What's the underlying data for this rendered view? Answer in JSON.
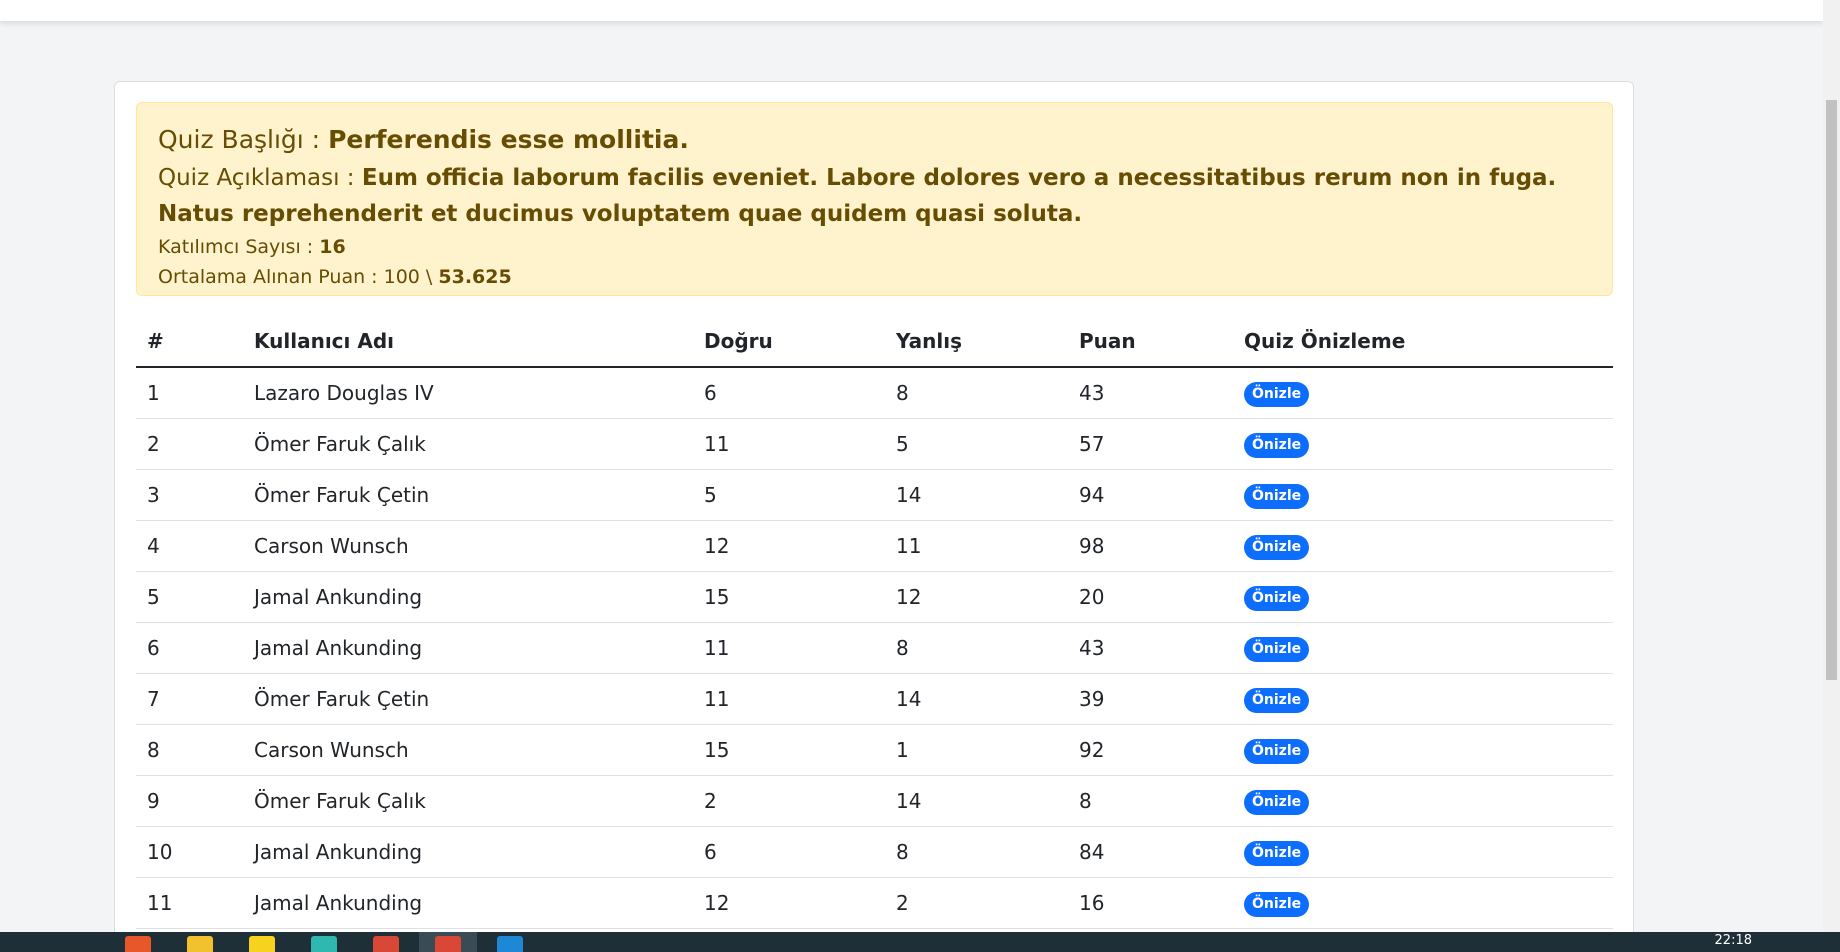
{
  "quiz": {
    "title_label": "Quiz Başlığı : ",
    "title_value": "Perferendis esse mollitia.",
    "desc_label": "Quiz Açıklaması : ",
    "desc_value": "Eum officia laborum facilis eveniet. Labore dolores vero a necessitatibus rerum non in fuga. Natus reprehenderit et ducimus voluptatem quae quidem quasi soluta.",
    "participants_label": "Katılımcı Sayısı : ",
    "participants_value": "16",
    "average_label": "Ortalama Alınan Puan : 100 \\ ",
    "average_value": "53.625"
  },
  "table": {
    "headers": [
      "#",
      "Kullanıcı Adı",
      "Doğru",
      "Yanlış",
      "Puan",
      "Quiz Önizleme"
    ],
    "preview_label": "Önizle",
    "rows": [
      {
        "idx": "1",
        "name": "Lazaro Douglas IV",
        "correct": "6",
        "wrong": "8",
        "score": "43"
      },
      {
        "idx": "2",
        "name": "Ömer Faruk Çalık",
        "correct": "11",
        "wrong": "5",
        "score": "57"
      },
      {
        "idx": "3",
        "name": "Ömer Faruk Çetin",
        "correct": "5",
        "wrong": "14",
        "score": "94"
      },
      {
        "idx": "4",
        "name": "Carson Wunsch",
        "correct": "12",
        "wrong": "11",
        "score": "98"
      },
      {
        "idx": "5",
        "name": "Jamal Ankunding",
        "correct": "15",
        "wrong": "12",
        "score": "20"
      },
      {
        "idx": "6",
        "name": "Jamal Ankunding",
        "correct": "11",
        "wrong": "8",
        "score": "43"
      },
      {
        "idx": "7",
        "name": "Ömer Faruk Çetin",
        "correct": "11",
        "wrong": "14",
        "score": "39"
      },
      {
        "idx": "8",
        "name": "Carson Wunsch",
        "correct": "15",
        "wrong": "1",
        "score": "92"
      },
      {
        "idx": "9",
        "name": "Ömer Faruk Çalık",
        "correct": "2",
        "wrong": "14",
        "score": "8"
      },
      {
        "idx": "10",
        "name": "Jamal Ankunding",
        "correct": "6",
        "wrong": "8",
        "score": "84"
      },
      {
        "idx": "11",
        "name": "Jamal Ankunding",
        "correct": "12",
        "wrong": "2",
        "score": "16"
      }
    ]
  },
  "taskbar": {
    "clock": "22:18"
  },
  "colors": {
    "alert_bg": "#fff3cd",
    "alert_text": "#664d03",
    "badge": "#0d6efd"
  }
}
